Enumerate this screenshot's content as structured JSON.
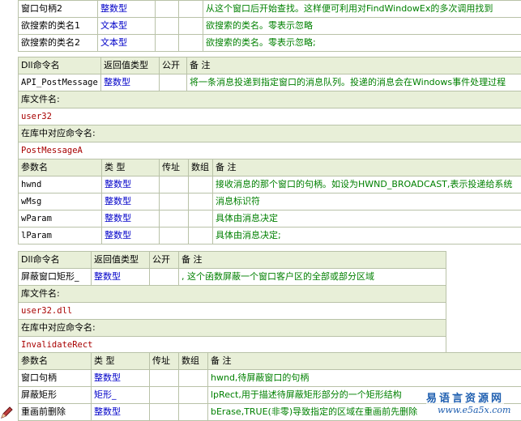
{
  "block0": {
    "rows": [
      {
        "name": "窗口句柄2",
        "type": "整数型",
        "note": "从这个窗口后开始查找。这样便可利用对FindWindowEx的多次调用找到"
      },
      {
        "name": "欲搜索的类名1",
        "type": "文本型",
        "note": "欲搜索的类名。零表示忽略"
      },
      {
        "name": "欲搜索的类名2",
        "type": "文本型",
        "note": "欲搜索的类名。零表示忽略;"
      }
    ]
  },
  "block1": {
    "header": {
      "cmd": "Dll命令名",
      "ret": "返回值类型",
      "pub": "公开",
      "note": "备 注"
    },
    "cmd_name": "API_PostMessage",
    "ret_type": "整数型",
    "note": "将一条消息投递到指定窗口的消息队列。投递的消息会在Windows事件处理过程",
    "lib_label": "库文件名:",
    "lib_value": "user32",
    "alias_label": "在库中对应命令名:",
    "alias_value": "PostMessageA",
    "param_header": {
      "name": "参数名",
      "type": "类 型",
      "byaddr": "传址",
      "array": "数组",
      "note": "备 注"
    },
    "params": [
      {
        "name": "hwnd",
        "type": "整数型",
        "note": "接收消息的那个窗口的句柄。如设为HWND_BROADCAST,表示投递给系统"
      },
      {
        "name": "wMsg",
        "type": "整数型",
        "note": "消息标识符"
      },
      {
        "name": "wParam",
        "type": "整数型",
        "note": "具体由消息决定"
      },
      {
        "name": "lParam",
        "type": "整数型",
        "note": "具体由消息决定;"
      }
    ]
  },
  "block2": {
    "header": {
      "cmd": "Dll命令名",
      "ret": "返回值类型",
      "pub": "公开",
      "note": "备 注"
    },
    "cmd_name": "屏蔽窗口矩形_",
    "ret_type": "整数型",
    "note": ", 这个函数屏蔽一个窗口客户区的全部或部分区域",
    "lib_label": "库文件名:",
    "lib_value": "user32.dll",
    "alias_label": "在库中对应命令名:",
    "alias_value": "InvalidateRect",
    "param_header": {
      "name": "参数名",
      "type": "类 型",
      "byaddr": "传址",
      "array": "数组",
      "note": "备 注"
    },
    "params": [
      {
        "name": "窗口句柄",
        "type": "整数型",
        "note": "hwnd,待屏蔽窗口的句柄"
      },
      {
        "name": "屏蔽矩形",
        "type": "矩形_",
        "note": "lpRect,用于描述待屏蔽矩形部分的一个矩形结构"
      },
      {
        "name": "重画前删除",
        "type": "整数型",
        "note": "bErase,TRUE(非零)导致指定的区域在重画前先删除"
      }
    ]
  },
  "watermark": {
    "site_name": "易语言资源网",
    "url": "www.e5a5x.com"
  },
  "colors": {
    "header_bg": "#e8efd8",
    "border": "#b9c2a8",
    "type_blue": "#0000c8",
    "note_green": "#008000",
    "lib_red": "#a80000"
  }
}
